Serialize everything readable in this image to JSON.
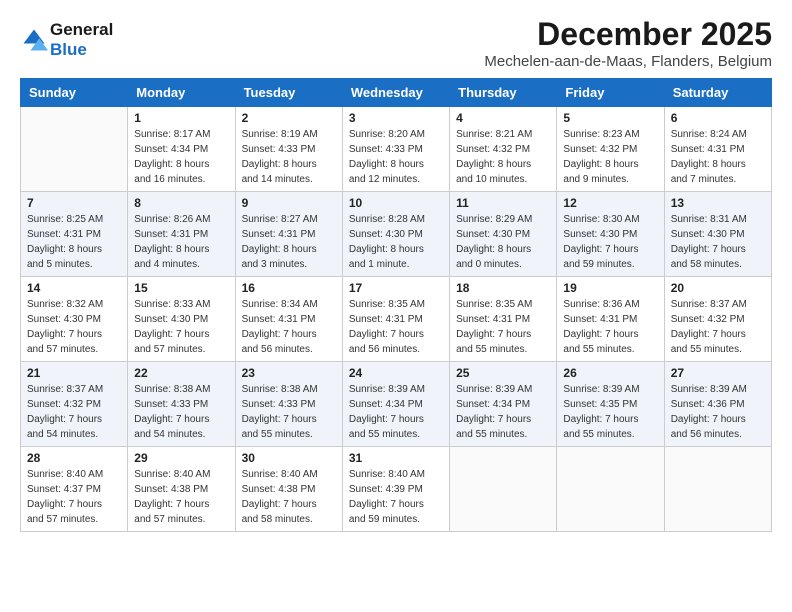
{
  "header": {
    "logo_line1": "General",
    "logo_line2": "Blue",
    "title": "December 2025",
    "subtitle": "Mechelen-aan-de-Maas, Flanders, Belgium"
  },
  "columns": [
    "Sunday",
    "Monday",
    "Tuesday",
    "Wednesday",
    "Thursday",
    "Friday",
    "Saturday"
  ],
  "weeks": [
    [
      {
        "day": "",
        "info": ""
      },
      {
        "day": "1",
        "info": "Sunrise: 8:17 AM\nSunset: 4:34 PM\nDaylight: 8 hours\nand 16 minutes."
      },
      {
        "day": "2",
        "info": "Sunrise: 8:19 AM\nSunset: 4:33 PM\nDaylight: 8 hours\nand 14 minutes."
      },
      {
        "day": "3",
        "info": "Sunrise: 8:20 AM\nSunset: 4:33 PM\nDaylight: 8 hours\nand 12 minutes."
      },
      {
        "day": "4",
        "info": "Sunrise: 8:21 AM\nSunset: 4:32 PM\nDaylight: 8 hours\nand 10 minutes."
      },
      {
        "day": "5",
        "info": "Sunrise: 8:23 AM\nSunset: 4:32 PM\nDaylight: 8 hours\nand 9 minutes."
      },
      {
        "day": "6",
        "info": "Sunrise: 8:24 AM\nSunset: 4:31 PM\nDaylight: 8 hours\nand 7 minutes."
      }
    ],
    [
      {
        "day": "7",
        "info": "Sunrise: 8:25 AM\nSunset: 4:31 PM\nDaylight: 8 hours\nand 5 minutes."
      },
      {
        "day": "8",
        "info": "Sunrise: 8:26 AM\nSunset: 4:31 PM\nDaylight: 8 hours\nand 4 minutes."
      },
      {
        "day": "9",
        "info": "Sunrise: 8:27 AM\nSunset: 4:31 PM\nDaylight: 8 hours\nand 3 minutes."
      },
      {
        "day": "10",
        "info": "Sunrise: 8:28 AM\nSunset: 4:30 PM\nDaylight: 8 hours\nand 1 minute."
      },
      {
        "day": "11",
        "info": "Sunrise: 8:29 AM\nSunset: 4:30 PM\nDaylight: 8 hours\nand 0 minutes."
      },
      {
        "day": "12",
        "info": "Sunrise: 8:30 AM\nSunset: 4:30 PM\nDaylight: 7 hours\nand 59 minutes."
      },
      {
        "day": "13",
        "info": "Sunrise: 8:31 AM\nSunset: 4:30 PM\nDaylight: 7 hours\nand 58 minutes."
      }
    ],
    [
      {
        "day": "14",
        "info": "Sunrise: 8:32 AM\nSunset: 4:30 PM\nDaylight: 7 hours\nand 57 minutes."
      },
      {
        "day": "15",
        "info": "Sunrise: 8:33 AM\nSunset: 4:30 PM\nDaylight: 7 hours\nand 57 minutes."
      },
      {
        "day": "16",
        "info": "Sunrise: 8:34 AM\nSunset: 4:31 PM\nDaylight: 7 hours\nand 56 minutes."
      },
      {
        "day": "17",
        "info": "Sunrise: 8:35 AM\nSunset: 4:31 PM\nDaylight: 7 hours\nand 56 minutes."
      },
      {
        "day": "18",
        "info": "Sunrise: 8:35 AM\nSunset: 4:31 PM\nDaylight: 7 hours\nand 55 minutes."
      },
      {
        "day": "19",
        "info": "Sunrise: 8:36 AM\nSunset: 4:31 PM\nDaylight: 7 hours\nand 55 minutes."
      },
      {
        "day": "20",
        "info": "Sunrise: 8:37 AM\nSunset: 4:32 PM\nDaylight: 7 hours\nand 55 minutes."
      }
    ],
    [
      {
        "day": "21",
        "info": "Sunrise: 8:37 AM\nSunset: 4:32 PM\nDaylight: 7 hours\nand 54 minutes."
      },
      {
        "day": "22",
        "info": "Sunrise: 8:38 AM\nSunset: 4:33 PM\nDaylight: 7 hours\nand 54 minutes."
      },
      {
        "day": "23",
        "info": "Sunrise: 8:38 AM\nSunset: 4:33 PM\nDaylight: 7 hours\nand 55 minutes."
      },
      {
        "day": "24",
        "info": "Sunrise: 8:39 AM\nSunset: 4:34 PM\nDaylight: 7 hours\nand 55 minutes."
      },
      {
        "day": "25",
        "info": "Sunrise: 8:39 AM\nSunset: 4:34 PM\nDaylight: 7 hours\nand 55 minutes."
      },
      {
        "day": "26",
        "info": "Sunrise: 8:39 AM\nSunset: 4:35 PM\nDaylight: 7 hours\nand 55 minutes."
      },
      {
        "day": "27",
        "info": "Sunrise: 8:39 AM\nSunset: 4:36 PM\nDaylight: 7 hours\nand 56 minutes."
      }
    ],
    [
      {
        "day": "28",
        "info": "Sunrise: 8:40 AM\nSunset: 4:37 PM\nDaylight: 7 hours\nand 57 minutes."
      },
      {
        "day": "29",
        "info": "Sunrise: 8:40 AM\nSunset: 4:38 PM\nDaylight: 7 hours\nand 57 minutes."
      },
      {
        "day": "30",
        "info": "Sunrise: 8:40 AM\nSunset: 4:38 PM\nDaylight: 7 hours\nand 58 minutes."
      },
      {
        "day": "31",
        "info": "Sunrise: 8:40 AM\nSunset: 4:39 PM\nDaylight: 7 hours\nand 59 minutes."
      },
      {
        "day": "",
        "info": ""
      },
      {
        "day": "",
        "info": ""
      },
      {
        "day": "",
        "info": ""
      }
    ]
  ],
  "colors": {
    "header_bg": "#1a6fc4",
    "logo_blue": "#1a6fc4"
  }
}
